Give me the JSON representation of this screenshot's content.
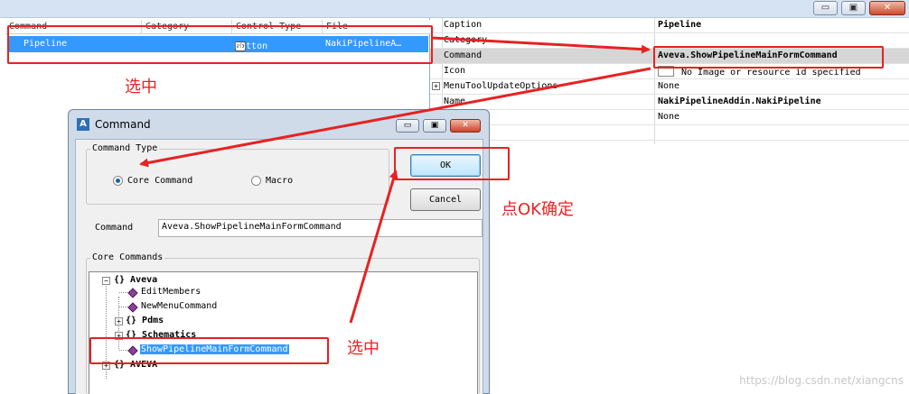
{
  "window_controls": {
    "minimize": "▭",
    "restore": "▣",
    "close": "✕"
  },
  "list": {
    "headers": [
      "Command",
      "Category",
      "Control Type",
      "File"
    ],
    "row": {
      "command": "Pipeline",
      "category": "",
      "control_icon": "ab",
      "control_type": "Button",
      "file": "NakiPipelineA…"
    }
  },
  "properties": [
    {
      "name": "Caption",
      "value": "Pipeline",
      "bold": true
    },
    {
      "name": "Category",
      "value": "",
      "bold": false
    },
    {
      "name": "Command",
      "value": "Aveva.ShowPipelineMainFormCommand",
      "bold": true
    },
    {
      "name": "Icon",
      "value": "No Image or resource id specified",
      "bold": false
    },
    {
      "name": "MenuToolUpdateOptions",
      "value": "None",
      "bold": false,
      "expander": "+"
    },
    {
      "name": "Name",
      "value": "NakiPipelineAddin.NakiPipeline",
      "bold": true
    },
    {
      "name": "",
      "value": "None",
      "bold": false
    },
    {
      "name": "",
      "value": "",
      "bold": false
    }
  ],
  "dialog": {
    "app_icon": "A",
    "title": "Command",
    "command_type_label": "Command Type",
    "radio_core": "Core Command",
    "radio_macro": "Macro",
    "ok": "OK",
    "cancel": "Cancel",
    "command_label": "Command",
    "command_value": "Aveva.ShowPipelineMainFormCommand",
    "core_commands_label": "Core Commands",
    "tree": {
      "aveva": "{} Aveva",
      "edit_members": "EditMembers",
      "new_menu_command": "NewMenuCommand",
      "pdms": "{} Pdms",
      "schematics": "{} Schematics",
      "show_pipeline": "ShowPipelineMainFormCommand",
      "aveva_upper": "{} AVEVA"
    }
  },
  "annotations": {
    "select_top": "选中",
    "ok_note": "点OK确定",
    "select_bottom": "选中"
  },
  "watermark": "https://blog.csdn.net/xiangcns",
  "colors": {
    "annotation_red": "#e62222",
    "selection_blue": "#3399ff"
  }
}
